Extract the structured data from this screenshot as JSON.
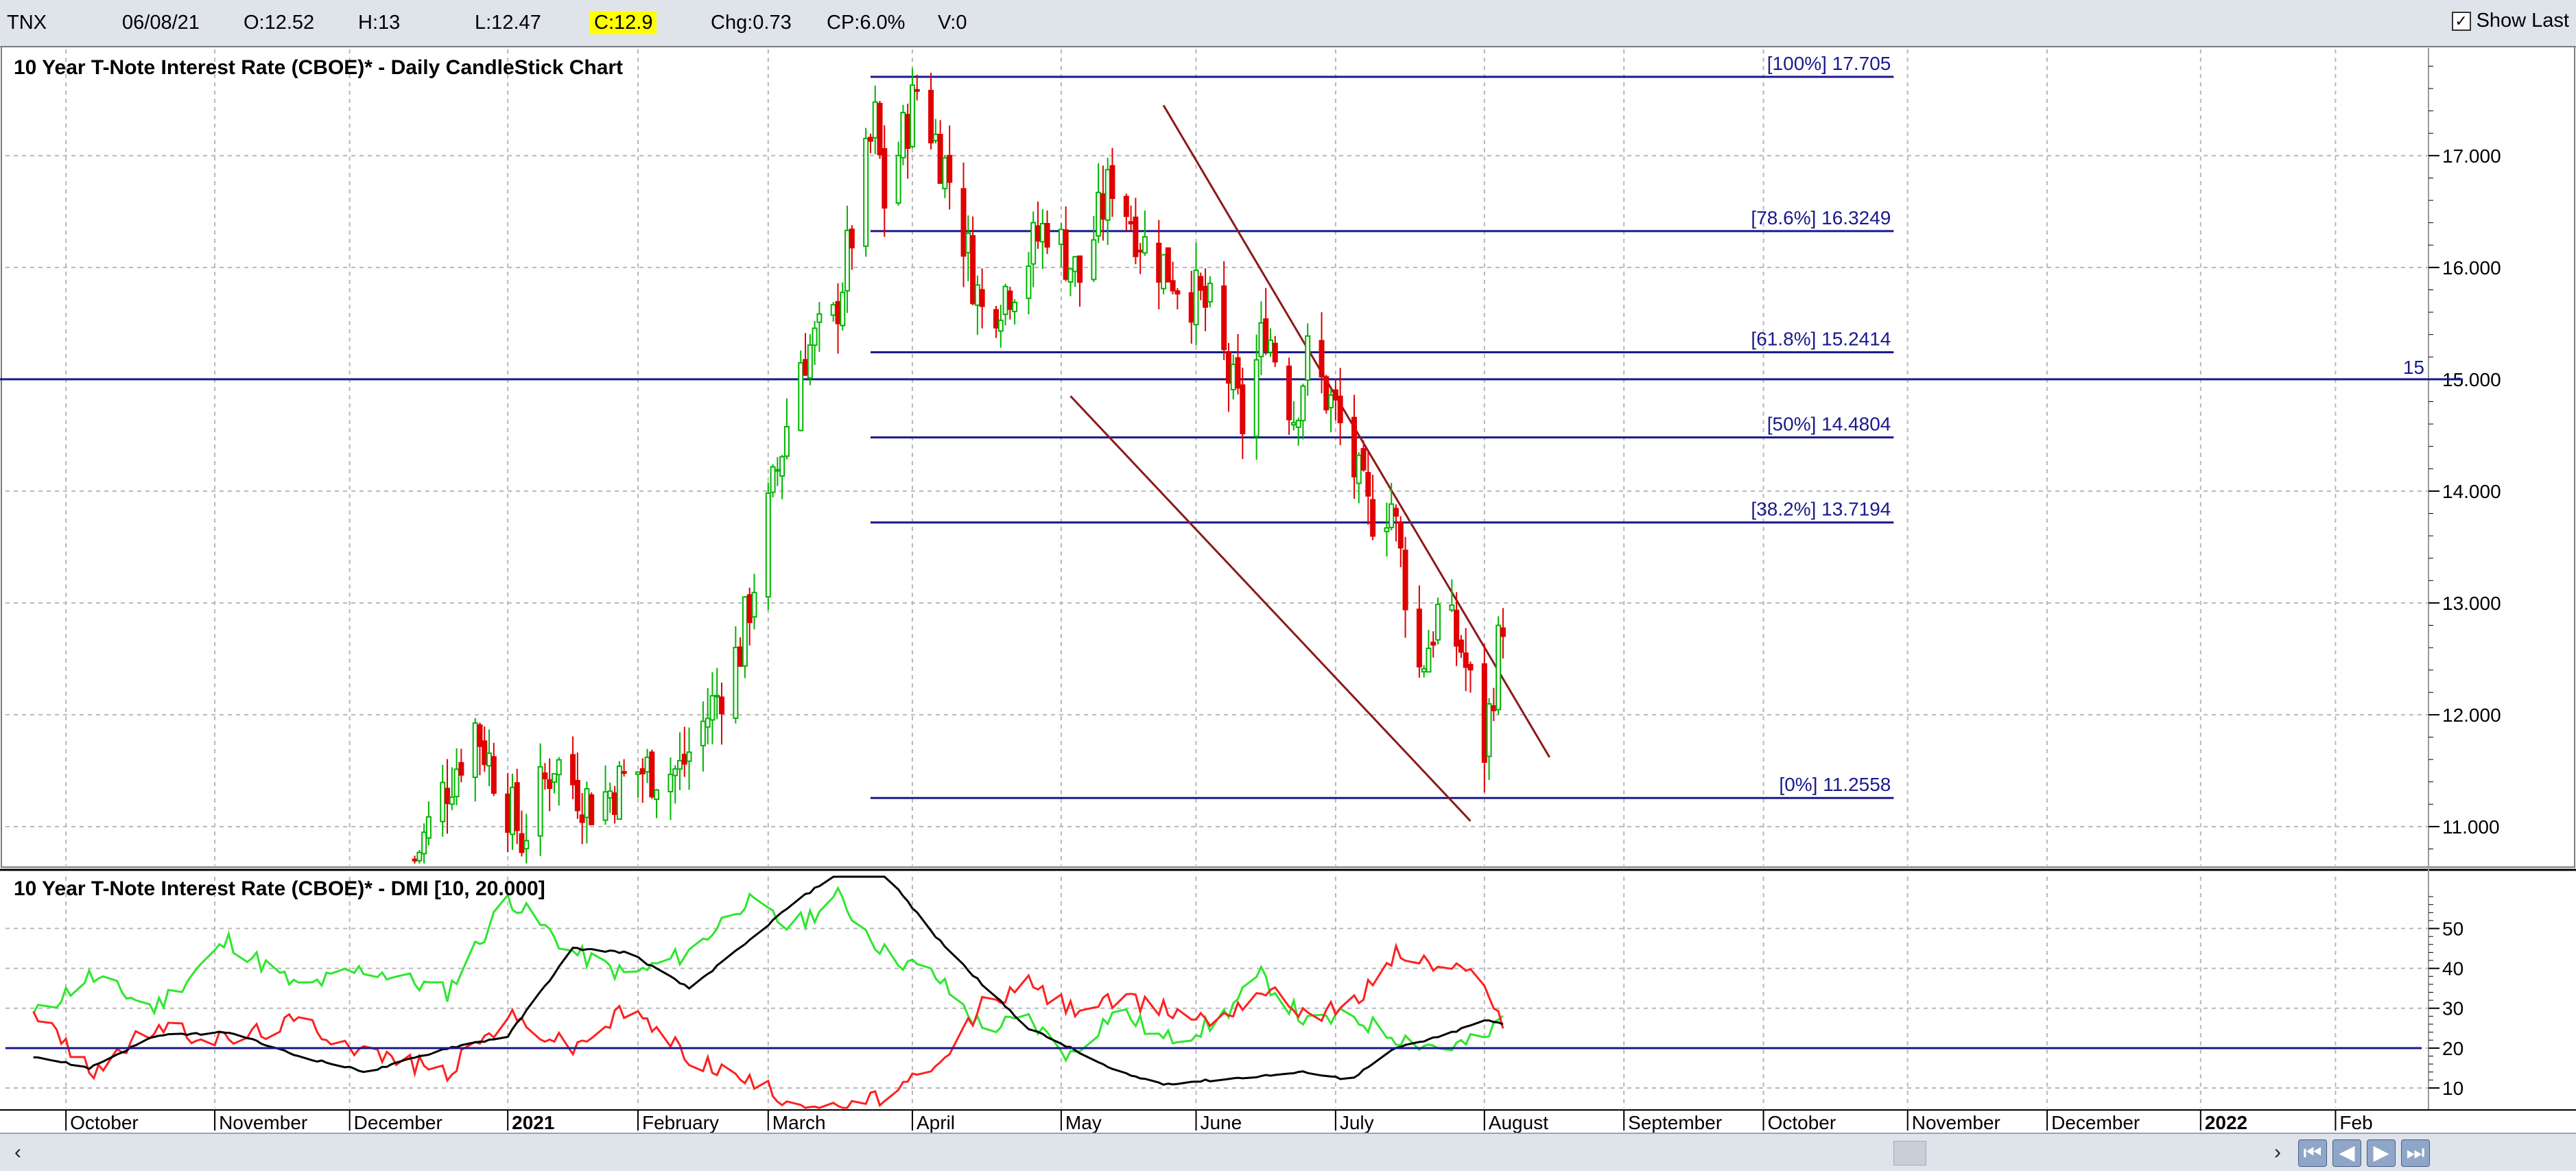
{
  "toolbar": {
    "symbol": "TNX",
    "date": "06/08/21",
    "open": "O:12.52",
    "high": "H:13",
    "low": "L:12.47",
    "close": "C:12.9",
    "change": "Chg:0.73",
    "change_pct": "CP:6.0%",
    "volume": "V:0",
    "show_last_label": "Show Last",
    "show_last_checked": true,
    "highlight_color": "#ffff00"
  },
  "colors": {
    "up": "#00b400",
    "down": "#e00000",
    "fib_line": "#1a1a8c",
    "channel": "#8b1a1a",
    "plus_di": "#2ee62e",
    "minus_di": "#ff2020",
    "adx": "#000000",
    "threshold": "#1a1a8c"
  },
  "icons": [
    "checkbox-checked-icon",
    "scroll-left-icon",
    "scroll-right-icon",
    "chart-thumb-icon",
    "first-icon",
    "prev-icon",
    "next-icon",
    "last-icon"
  ],
  "chart_data": [
    {
      "type": "candlestick",
      "title": "10 Year T-Note Interest Rate (CBOE)* - Daily CandleStick Chart",
      "ylim": [
        10.65,
        17.95
      ],
      "y_ticks": [
        11,
        12,
        13,
        14,
        15,
        16,
        17
      ],
      "y_tick_labels": [
        "11.000",
        "12.000",
        "13.000",
        "14.000",
        "15.000",
        "16.000",
        "17.000"
      ],
      "grid": true,
      "horizontal_line": {
        "value": 15,
        "label": "15"
      },
      "fibonacci": {
        "from_date": "2021-03-23",
        "to_date": "2021-10-29",
        "levels": [
          {
            "label": "[100%] 17.705",
            "value": 17.705
          },
          {
            "label": "[78.6%] 16.3249",
            "value": 16.3249
          },
          {
            "label": "[61.8%] 15.2414",
            "value": 15.2414
          },
          {
            "label": "[50%] 14.4804",
            "value": 14.4804
          },
          {
            "label": "[38.2%] 13.7194",
            "value": 13.7194
          },
          {
            "label": "[0%] 11.2558",
            "value": 11.2558
          }
        ]
      },
      "trendlines": [
        {
          "from": [
            "2021-05-25",
            17.45
          ],
          "to": [
            "2021-08-16",
            11.62
          ]
        },
        {
          "from": [
            "2021-05-05",
            14.85
          ],
          "to": [
            "2021-07-30",
            11.05
          ]
        }
      ],
      "anchors": [
        [
          "2020-12-15",
          10.7
        ],
        [
          "2020-12-21",
          11.3
        ],
        [
          "2020-12-28",
          11.9
        ],
        [
          "2021-01-07",
          10.9
        ],
        [
          "2021-01-14",
          11.6
        ],
        [
          "2021-01-22",
          11.2
        ],
        [
          "2021-02-01",
          11.5
        ],
        [
          "2021-02-10",
          11.5
        ],
        [
          "2021-02-16",
          12.0
        ],
        [
          "2021-02-23",
          12.6
        ],
        [
          "2021-03-01",
          13.8
        ],
        [
          "2021-03-08",
          15.2
        ],
        [
          "2021-03-15",
          15.5
        ],
        [
          "2021-03-19",
          16.3
        ],
        [
          "2021-03-24",
          17.3
        ],
        [
          "2021-03-26",
          16.6
        ],
        [
          "2021-04-02",
          17.6
        ],
        [
          "2021-04-09",
          16.8
        ],
        [
          "2021-04-16",
          15.6
        ],
        [
          "2021-04-23",
          15.9
        ],
        [
          "2021-04-30",
          16.4
        ],
        [
          "2021-05-07",
          15.9
        ],
        [
          "2021-05-14",
          16.8
        ],
        [
          "2021-05-21",
          16.2
        ],
        [
          "2021-05-28",
          15.9
        ],
        [
          "2021-06-04",
          15.6
        ],
        [
          "2021-06-11",
          14.6
        ],
        [
          "2021-06-16",
          15.5
        ],
        [
          "2021-06-22",
          14.7
        ],
        [
          "2021-06-25",
          15.2
        ],
        [
          "2021-07-01",
          14.7
        ],
        [
          "2021-07-08",
          13.8
        ],
        [
          "2021-07-13",
          13.9
        ],
        [
          "2021-07-19",
          12.4
        ],
        [
          "2021-07-23",
          12.9
        ],
        [
          "2021-07-28",
          12.6
        ],
        [
          "2021-08-02",
          11.7
        ],
        [
          "2021-08-06",
          12.9
        ]
      ]
    },
    {
      "type": "line",
      "title": "10 Year T-Note Interest Rate (CBOE)* - DMI [10, 20.000]",
      "ylim": [
        5,
        63
      ],
      "y_ticks": [
        10,
        20,
        30,
        40,
        50
      ],
      "threshold": 20,
      "series": [
        {
          "name": "+DI",
          "anchors": [
            [
              "2020-09-24",
              28
            ],
            [
              "2020-10-06",
              38
            ],
            [
              "2020-10-20",
              30
            ],
            [
              "2020-11-05",
              47
            ],
            [
              "2020-11-20",
              35
            ],
            [
              "2020-12-05",
              40
            ],
            [
              "2020-12-22",
              34
            ],
            [
              "2021-01-04",
              58
            ],
            [
              "2021-01-18",
              44
            ],
            [
              "2021-01-30",
              38
            ],
            [
              "2021-02-12",
              44
            ],
            [
              "2021-02-24",
              57
            ],
            [
              "2021-03-06",
              50
            ],
            [
              "2021-03-16",
              58
            ],
            [
              "2021-03-26",
              44
            ],
            [
              "2021-04-06",
              38
            ],
            [
              "2021-04-16",
              25
            ],
            [
              "2021-04-26",
              27
            ],
            [
              "2021-05-05",
              18
            ],
            [
              "2021-05-15",
              30
            ],
            [
              "2021-05-25",
              22
            ],
            [
              "2021-06-05",
              26
            ],
            [
              "2021-06-15",
              38
            ],
            [
              "2021-06-25",
              26
            ],
            [
              "2021-07-04",
              28
            ],
            [
              "2021-07-14",
              23
            ],
            [
              "2021-07-24",
              20
            ],
            [
              "2021-08-02",
              22
            ],
            [
              "2021-08-06",
              28
            ]
          ]
        },
        {
          "name": "-DI",
          "anchors": [
            [
              "2020-09-24",
              30
            ],
            [
              "2020-10-06",
              14
            ],
            [
              "2020-10-20",
              25
            ],
            [
              "2020-11-05",
              22
            ],
            [
              "2020-11-20",
              27
            ],
            [
              "2020-12-05",
              19
            ],
            [
              "2020-12-22",
              14
            ],
            [
              "2021-01-04",
              28
            ],
            [
              "2021-01-18",
              20
            ],
            [
              "2021-01-30",
              30
            ],
            [
              "2021-02-12",
              18
            ],
            [
              "2021-02-24",
              12
            ],
            [
              "2021-03-06",
              7
            ],
            [
              "2021-03-16",
              4
            ],
            [
              "2021-03-26",
              8
            ],
            [
              "2021-04-06",
              14
            ],
            [
              "2021-04-16",
              31
            ],
            [
              "2021-04-26",
              36
            ],
            [
              "2021-05-05",
              30
            ],
            [
              "2021-05-15",
              32
            ],
            [
              "2021-05-25",
              30
            ],
            [
              "2021-06-05",
              27
            ],
            [
              "2021-06-15",
              35
            ],
            [
              "2021-06-25",
              29
            ],
            [
              "2021-07-04",
              30
            ],
            [
              "2021-07-14",
              44
            ],
            [
              "2021-07-24",
              40
            ],
            [
              "2021-08-02",
              38
            ],
            [
              "2021-08-06",
              25
            ]
          ]
        },
        {
          "name": "ADX",
          "anchors": [
            [
              "2020-09-24",
              18
            ],
            [
              "2020-10-06",
              15
            ],
            [
              "2020-10-20",
              23
            ],
            [
              "2020-11-05",
              24
            ],
            [
              "2020-11-20",
              18
            ],
            [
              "2020-12-05",
              14
            ],
            [
              "2020-12-22",
              20
            ],
            [
              "2021-01-04",
              23
            ],
            [
              "2021-01-18",
              45
            ],
            [
              "2021-01-30",
              44
            ],
            [
              "2021-02-12",
              35
            ],
            [
              "2021-02-24",
              46
            ],
            [
              "2021-03-06",
              56
            ],
            [
              "2021-03-16",
              64
            ],
            [
              "2021-03-26",
              64
            ],
            [
              "2021-04-06",
              48
            ],
            [
              "2021-04-16",
              36
            ],
            [
              "2021-04-26",
              25
            ],
            [
              "2021-05-05",
              20
            ],
            [
              "2021-05-15",
              14
            ],
            [
              "2021-05-25",
              11
            ],
            [
              "2021-06-05",
              12
            ],
            [
              "2021-06-15",
              13
            ],
            [
              "2021-06-25",
              14
            ],
            [
              "2021-07-04",
              12
            ],
            [
              "2021-07-14",
              20
            ],
            [
              "2021-07-24",
              23
            ],
            [
              "2021-08-02",
              27
            ],
            [
              "2021-08-06",
              26
            ]
          ]
        }
      ]
    }
  ],
  "x_axis": {
    "labels": [
      {
        "text": "October",
        "date": "2020-10-01"
      },
      {
        "text": "November",
        "date": "2020-11-02"
      },
      {
        "text": "December",
        "date": "2020-12-01"
      },
      {
        "text": "2021",
        "date": "2021-01-04",
        "bold": true
      },
      {
        "text": "February",
        "date": "2021-02-01"
      },
      {
        "text": "March",
        "date": "2021-03-01"
      },
      {
        "text": "April",
        "date": "2021-04-01"
      },
      {
        "text": "May",
        "date": "2021-05-03"
      },
      {
        "text": "June",
        "date": "2021-06-01"
      },
      {
        "text": "July",
        "date": "2021-07-01"
      },
      {
        "text": "August",
        "date": "2021-08-02"
      },
      {
        "text": "September",
        "date": "2021-09-01"
      },
      {
        "text": "October",
        "date": "2021-10-01"
      },
      {
        "text": "November",
        "date": "2021-11-01"
      },
      {
        "text": "December",
        "date": "2021-12-01"
      },
      {
        "text": "2022",
        "date": "2022-01-03",
        "bold": true
      },
      {
        "text": "Feb",
        "date": "2022-02-01"
      }
    ]
  }
}
